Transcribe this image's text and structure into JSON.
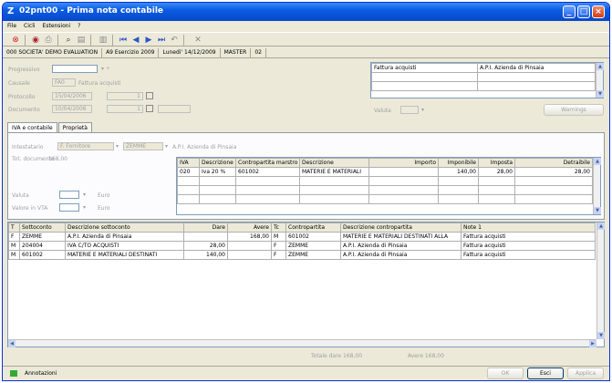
{
  "window": {
    "title": "02pnt00 - Prima nota contabile",
    "app_icon": "Z"
  },
  "menu": [
    "File",
    "Cicli",
    "Estensioni",
    "?"
  ],
  "status": [
    "000 SOCIETA' DEMO EVALUATION",
    "A9 Esercizio 2009",
    "Lunedi' 14/12/2009",
    "MASTER",
    "02"
  ],
  "form": {
    "progressivo_label": "Progressivo",
    "causale_label": "Causale",
    "causale_value": "FA0",
    "causale_desc": "Fattura acquisti",
    "protocollo_label": "Protocollo",
    "protocollo_date": "15/04/2006",
    "protocollo_num": "1",
    "documento_label": "Documento",
    "documento_date": "10/04/2006",
    "documento_num": "1",
    "valuta_top_label": "Valuta",
    "note_button": "Warnings"
  },
  "info_box": {
    "rows": [
      [
        "Fattura acquisti",
        "A.P.I. Azienda di Pinsaia"
      ],
      [
        "",
        ""
      ],
      [
        "",
        ""
      ]
    ]
  },
  "tabs": [
    "IVA e contabile",
    "Proprietà"
  ],
  "iva_tab": {
    "intestatario_label": "Intestatario",
    "intestatario_type": "F. Fornitore",
    "intestatario_code": "ZEMME",
    "intestatario_name": "A.P.I. Azienda di Pinsaia",
    "tot_doc_label": "Tot. documento",
    "tot_doc_value": "168,00",
    "valuta_label": "Valuta",
    "valuta_suffix": "Euro",
    "valore_label": "Valore in VTA",
    "valore_suffix": "Euro",
    "iva_headers": [
      "IVA",
      "Descrizione",
      "Contropartita marstro",
      "Descrizione",
      "Importo",
      "Imponibile",
      "Imposta",
      "Detraibile"
    ],
    "iva_rows": [
      [
        "020",
        "Iva 20 %",
        "601002",
        "MATERIE E MATERIALI",
        "",
        "140,00",
        "28,00",
        "28,00"
      ]
    ]
  },
  "movements": {
    "headers": [
      "T",
      "Sottoconto",
      "Descrizione sottoconto",
      "Dare",
      "Avere",
      "Tc",
      "Contropartita",
      "Descrizione contropartita",
      "Note 1"
    ],
    "rows": [
      [
        "F",
        "ZEMME",
        "A.P.I. Azienda di Pinsaia",
        "",
        "168,00",
        "M",
        "601002",
        "MATERIE E MATERIALI DESTINATI ALLA",
        "Fattura acquisti"
      ],
      [
        "M",
        "204004",
        "IVA C/TO ACQUISTI",
        "28,00",
        "",
        "F",
        "ZEMME",
        "A.P.I. Azienda di Pinsaia",
        "Fattura acquisti"
      ],
      [
        "M",
        "601002",
        "MATERIE E MATERIALI DESTINATI",
        "140,00",
        "",
        "F",
        "ZEMME",
        "A.P.I. Azienda di Pinsaia",
        "Fattura acquisti"
      ]
    ]
  },
  "totals": {
    "dare": "Totale dare 168,00",
    "avere": "Avere 168,00"
  },
  "footer": {
    "annotazioni": "Annotazioni",
    "ok": "OK",
    "esci": "Esci",
    "applica": "Applica"
  },
  "colors": {
    "title_bar": "#0a5ce3",
    "window_bg": "#ece9d8"
  }
}
